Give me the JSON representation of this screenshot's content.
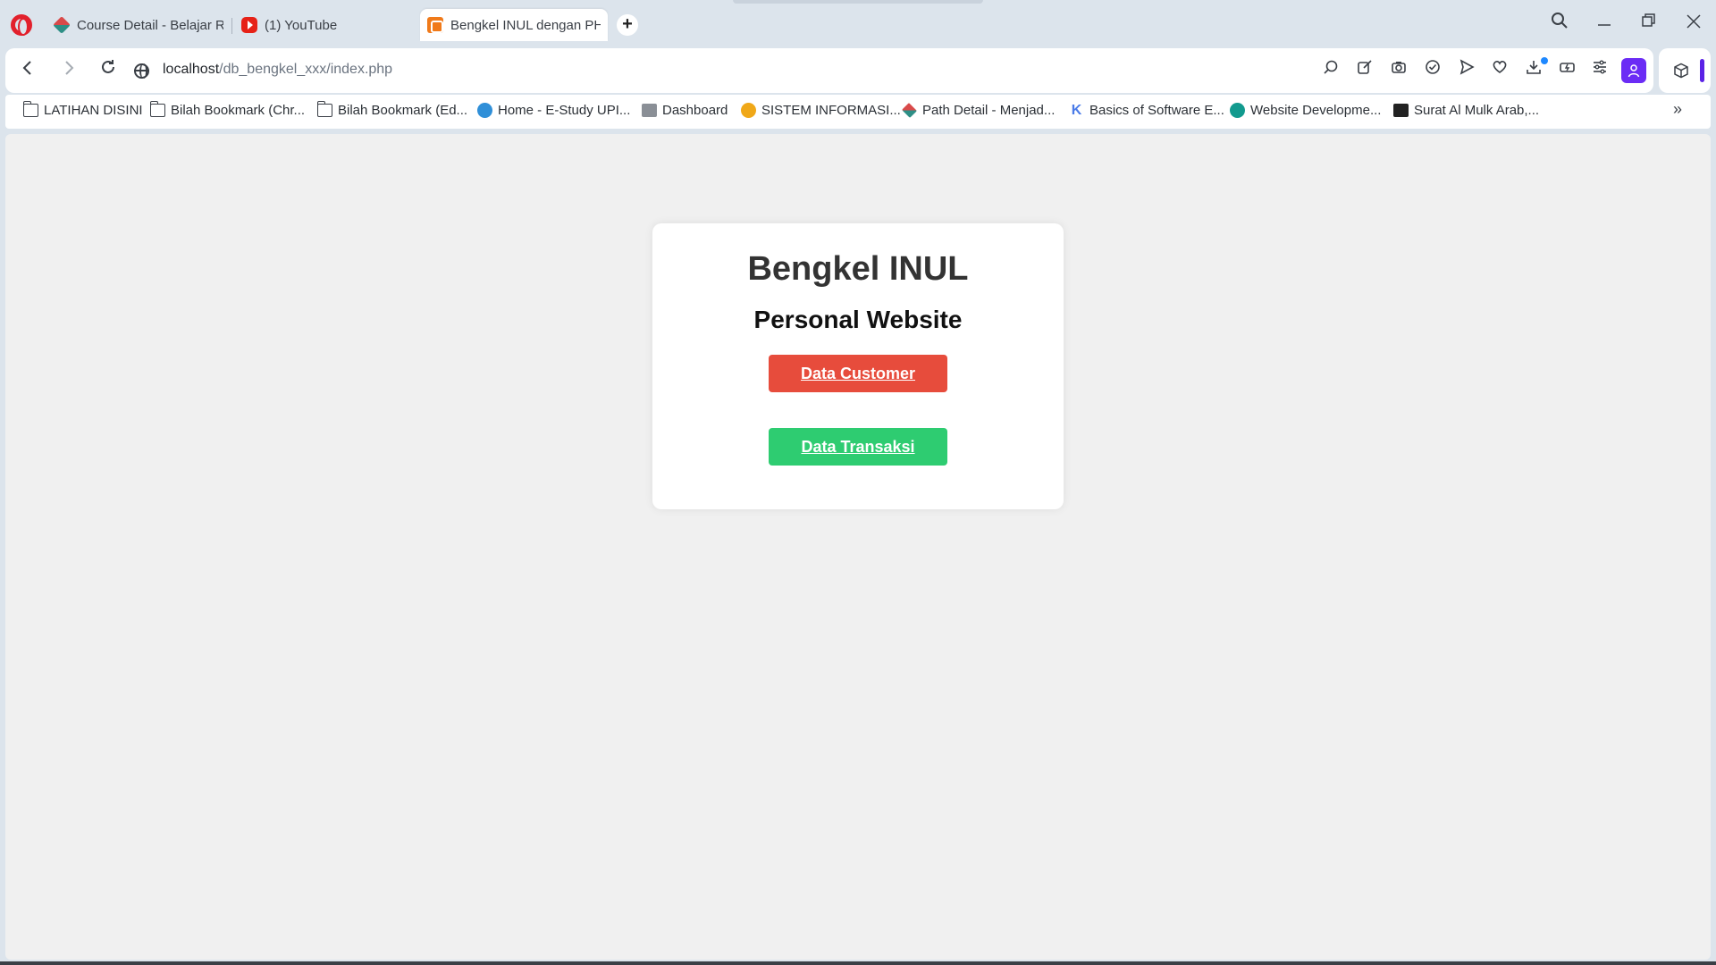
{
  "browser": {
    "tabs": [
      {
        "label": "Course Detail - Belajar Re",
        "icon": "dicoding-icon"
      },
      {
        "label": "(1) YouTube",
        "icon": "youtube-icon"
      },
      {
        "label": "Bengkel INUL dengan PHP",
        "icon": "xampp-icon",
        "active": true
      }
    ],
    "new_tab_label": "+",
    "address": {
      "host": "localhost",
      "path": "/db_bengkel_xxx/index.php"
    },
    "bookmarks": [
      {
        "label": "LATIHAN DISINI",
        "icon": "folder-icon"
      },
      {
        "label": "Bilah Bookmark (Chr...",
        "icon": "folder-icon"
      },
      {
        "label": "Bilah Bookmark (Ed...",
        "icon": "folder-icon"
      },
      {
        "label": "Home - E-Study UPI...",
        "icon": "estudy-icon"
      },
      {
        "label": "Dashboard",
        "icon": "dashboard-icon"
      },
      {
        "label": "SISTEM INFORMASI...",
        "icon": "sistem-icon"
      },
      {
        "label": "Path Detail - Menjad...",
        "icon": "dicoding-icon"
      },
      {
        "label": "Basics of Software E...",
        "icon": "k-icon"
      },
      {
        "label": "Website Developme...",
        "icon": "globe-icon"
      },
      {
        "label": "Surat Al Mulk Arab,...",
        "icon": "quran-icon"
      }
    ],
    "colors": {
      "accent_profile": "#6b2cf5",
      "opera_red": "#e2202c"
    }
  },
  "page": {
    "title": "Bengkel INUL",
    "subtitle": "Personal Website",
    "buttons": {
      "customer": "Data Customer",
      "transaksi": "Data Transaksi"
    },
    "colors": {
      "customer_button": "#e74c3c",
      "transaksi_button": "#2ecc71",
      "background": "#f0f0f0",
      "card": "#ffffff"
    }
  }
}
